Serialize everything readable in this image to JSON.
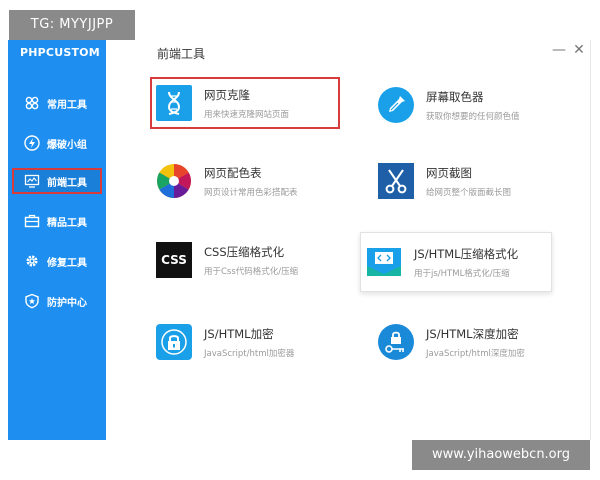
{
  "watermark_top": "TG: MYYJJPP",
  "watermark_bottom": "www.yihaowebcn.org",
  "app": {
    "brand": "PHPCUSTOM",
    "content_title": "前端工具"
  },
  "window_controls": {
    "minimize": "—",
    "close": "✕"
  },
  "sidebar": {
    "items": [
      {
        "label": "常用工具",
        "icon": "puzzle-icon"
      },
      {
        "label": "爆破小组",
        "icon": "lightning-icon"
      },
      {
        "label": "前端工具",
        "icon": "monitor-icon",
        "active": true
      },
      {
        "label": "精品工具",
        "icon": "toolbox-icon"
      },
      {
        "label": "修复工具",
        "icon": "gear-icon"
      },
      {
        "label": "防护中心",
        "icon": "shield-icon"
      }
    ]
  },
  "tools": [
    {
      "name": "网页克隆",
      "desc": "用来快速克隆网站页面",
      "icon": "dna-icon"
    },
    {
      "name": "屏幕取色器",
      "desc": "获取你想要的任何颜色值",
      "icon": "eyedropper-icon"
    },
    {
      "name": "网页配色表",
      "desc": "网页设计常用色彩搭配表",
      "icon": "color-wheel-icon"
    },
    {
      "name": "网页截图",
      "desc": "给网页整个版面截长图",
      "icon": "scissors-icon"
    },
    {
      "name": "CSS压缩格式化",
      "desc": "用于Css代码格式化/压缩",
      "icon": "css-icon",
      "icon_text": "CSS"
    },
    {
      "name": "JS/HTML压缩格式化",
      "desc": "用于js/HTML格式化/压缩",
      "icon": "code-envelope-icon"
    },
    {
      "name": "JS/HTML加密",
      "desc": "JavaScript/html加密器",
      "icon": "lock-icon"
    },
    {
      "name": "JS/HTML深度加密",
      "desc": "JavaScript/html深度加密",
      "icon": "key-lock-icon"
    }
  ],
  "colors": {
    "sidebar": "#1e8ff0",
    "highlight": "#d83b3b",
    "icon_blue": "#1aa0e8"
  }
}
